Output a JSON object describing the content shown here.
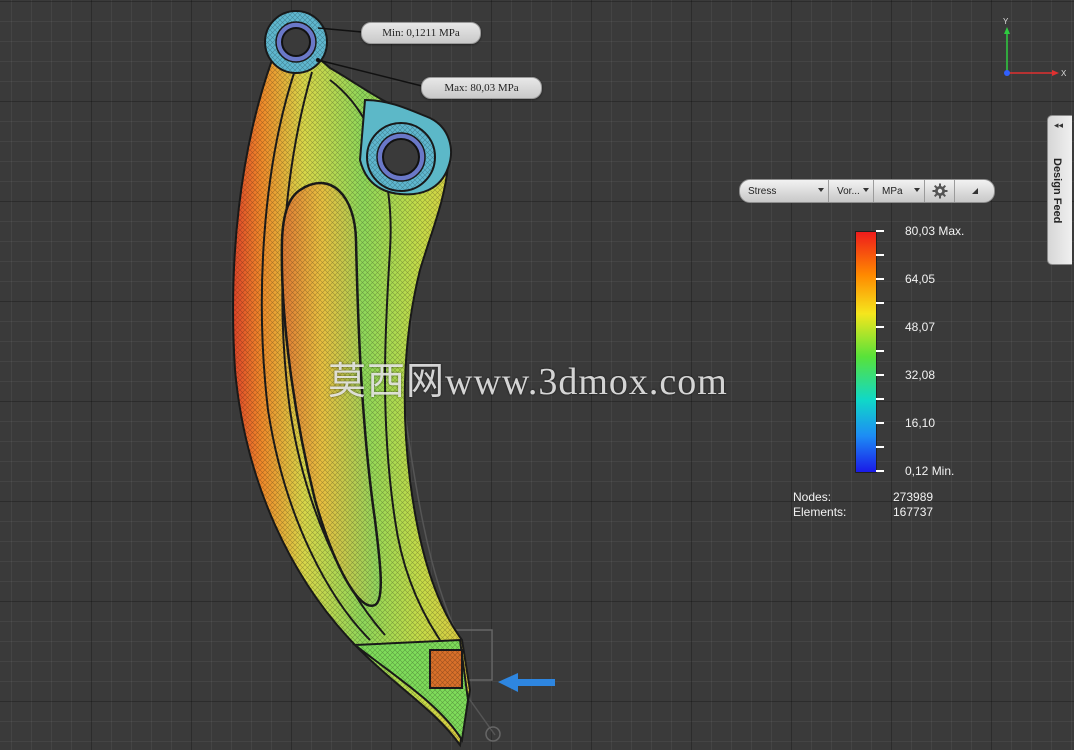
{
  "probes": {
    "min_label": "Min: 0,1211 MPa",
    "max_label": "Max: 80,03 MPa"
  },
  "watermark": "莫西网www.3dmox.com",
  "result_toolbar": {
    "result_type": "Stress",
    "component": "Vor...",
    "unit": "MPa",
    "settings_icon": "gear-icon",
    "expand_icon": "expand-corner-icon"
  },
  "legend": {
    "labels": [
      "80,03 Max.",
      "64,05",
      "48,07",
      "32,08",
      "16,10",
      "0,12 Min."
    ],
    "colors": {
      "max": "#ee1c1c",
      "high": "#ff8a00",
      "mid_high": "#f5e61d",
      "mid": "#58e23a",
      "mid_low": "#10d8c8",
      "low": "#1d8cf5",
      "min": "#1a1ae8"
    }
  },
  "mesh_stats": {
    "nodes_label": "Nodes:",
    "nodes_value": "273989",
    "elements_label": "Elements:",
    "elements_value": "167737"
  },
  "design_feed": {
    "label": "Design Feed",
    "toggle": "◂◂"
  },
  "view_cube": {
    "axis_y": "Y",
    "axis_x": "X"
  },
  "load_arrow_icon": "arrow-left-icon"
}
